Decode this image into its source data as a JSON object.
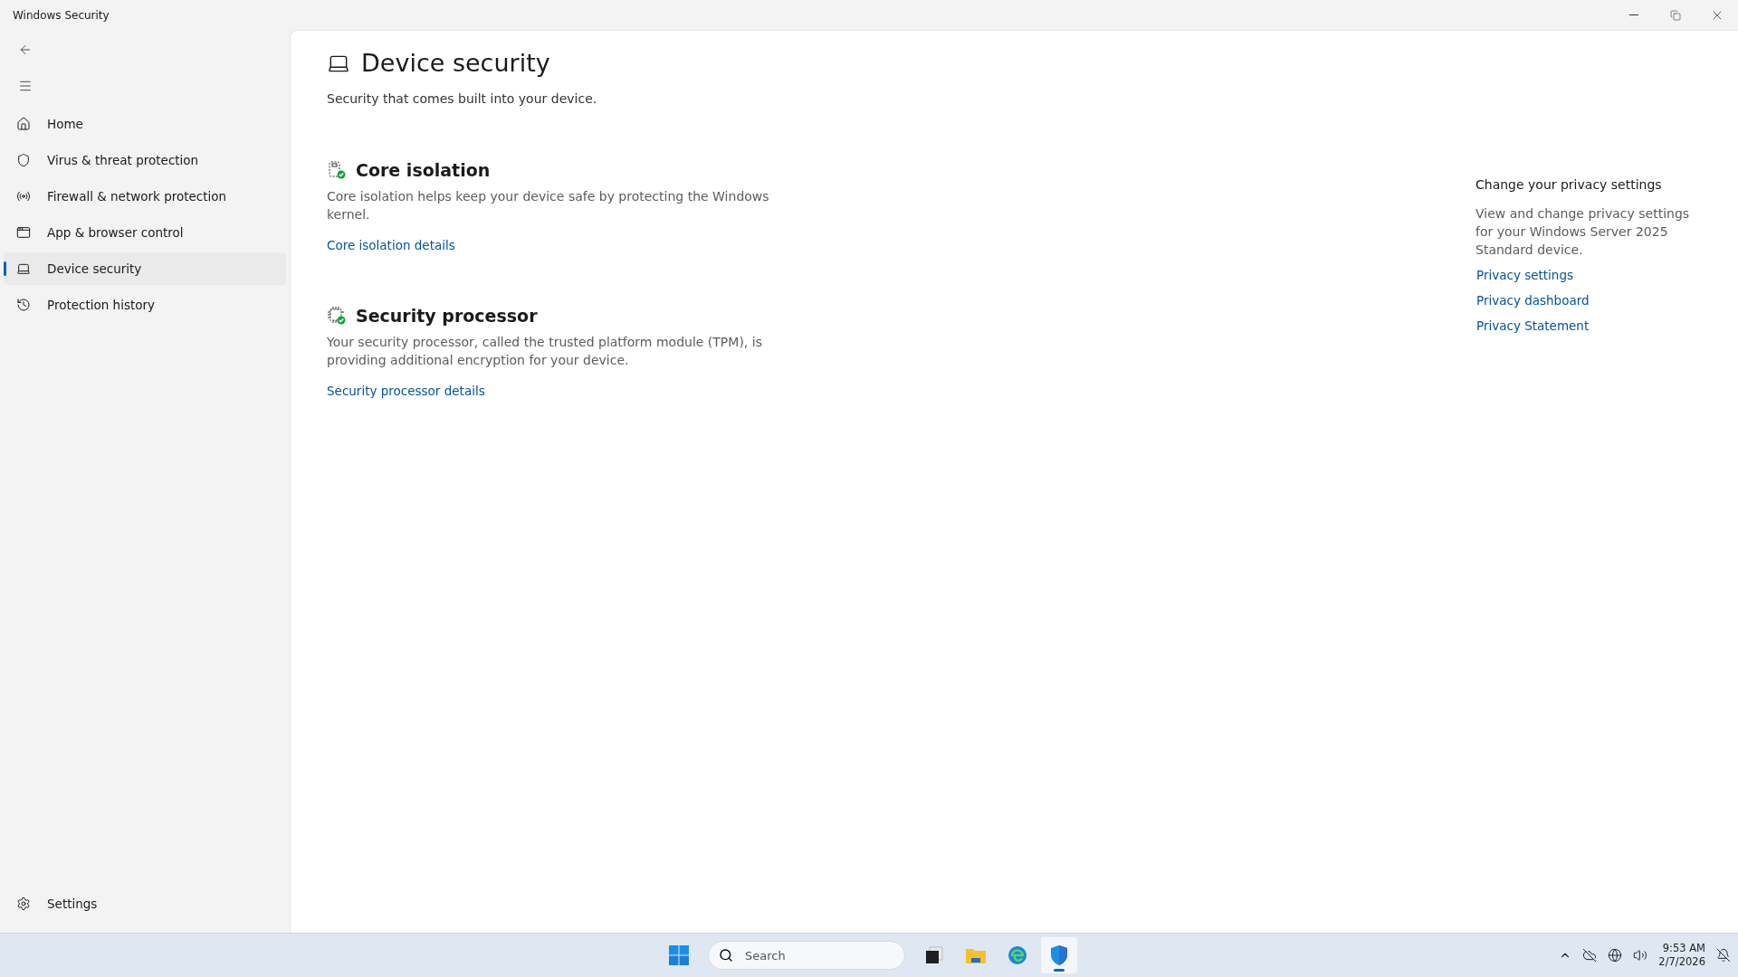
{
  "window": {
    "title": "Windows Security"
  },
  "sidebar": {
    "items": [
      {
        "label": "Home",
        "selected": false
      },
      {
        "label": "Virus & threat protection",
        "selected": false
      },
      {
        "label": "Firewall & network protection",
        "selected": false
      },
      {
        "label": "App & browser control",
        "selected": false
      },
      {
        "label": "Device security",
        "selected": true
      },
      {
        "label": "Protection history",
        "selected": false
      }
    ],
    "settings": {
      "label": "Settings"
    }
  },
  "page": {
    "title": "Device security",
    "subtitle": "Security that comes built into your device.",
    "sections": [
      {
        "title": "Core isolation",
        "description": "Core isolation helps keep your device safe by protecting the Windows kernel.",
        "link": "Core isolation details"
      },
      {
        "title": "Security processor",
        "description": "Your security processor, called the trusted platform module (TPM), is providing additional encryption for your device.",
        "link": "Security processor details"
      }
    ]
  },
  "privacy": {
    "title": "Change your privacy settings",
    "description": "View and change privacy settings for your Windows Server 2025 Standard device.",
    "links": [
      "Privacy settings",
      "Privacy dashboard",
      "Privacy Statement"
    ]
  },
  "taskbar": {
    "search": {
      "placeholder": "Search"
    },
    "apps": [
      {
        "kind": "taskview",
        "selected": false
      },
      {
        "kind": "folder",
        "selected": false
      },
      {
        "kind": "browser",
        "selected": false
      },
      {
        "kind": "security",
        "selected": true
      }
    ],
    "time": "9:53 AM",
    "date": "2/7/2026"
  }
}
